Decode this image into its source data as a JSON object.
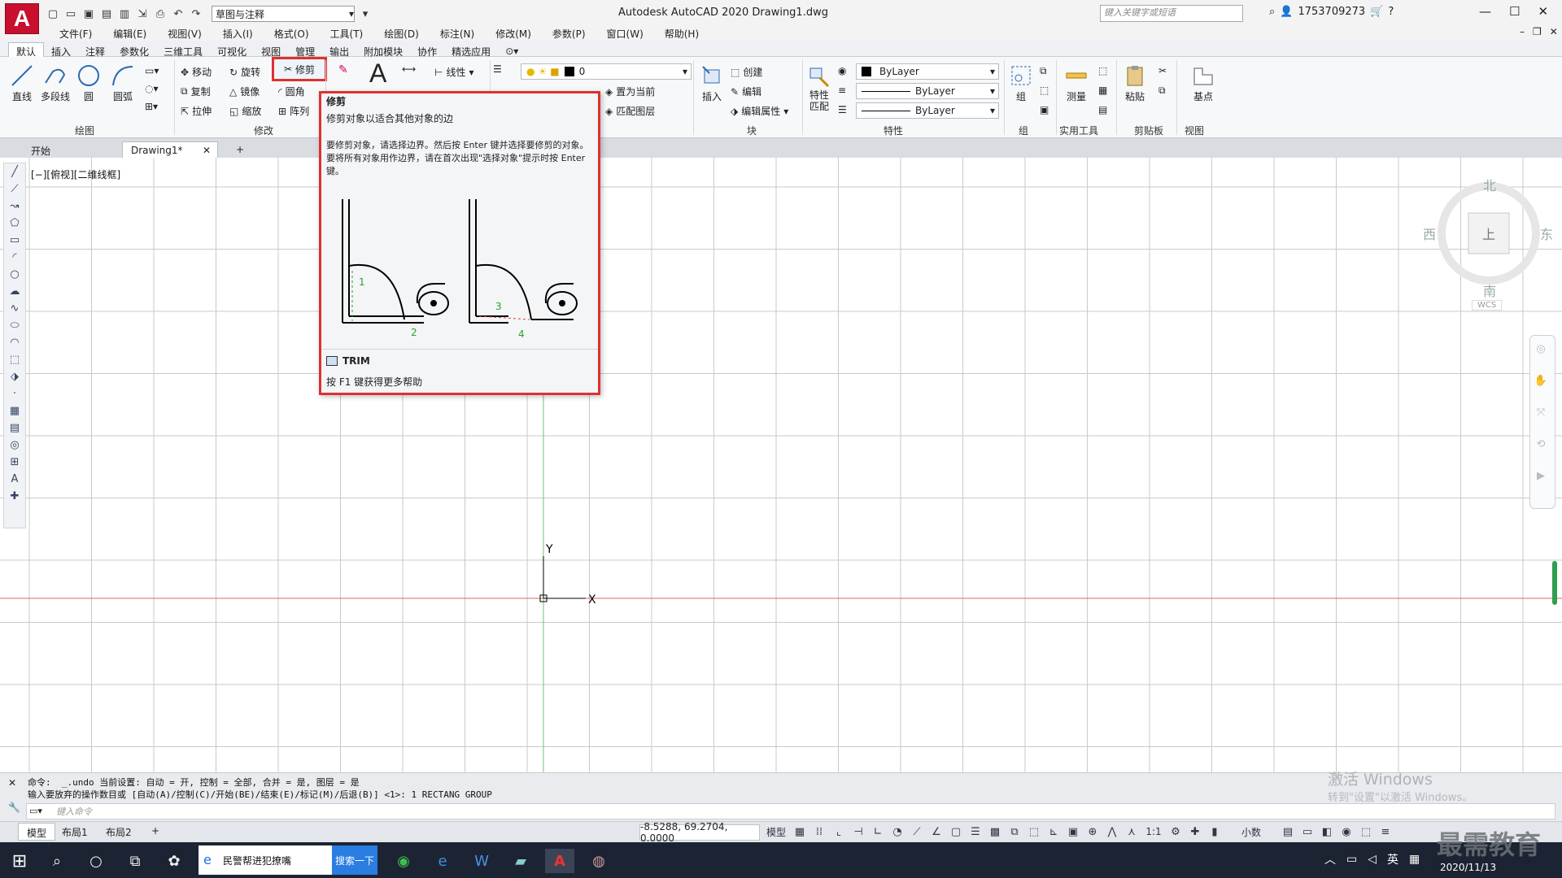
{
  "window": {
    "app_title": "Autodesk AutoCAD 2020    Drawing1.dwg",
    "logo_letter": "A",
    "workspace": "草图与注释",
    "search_placeholder": "键入关键字或短语",
    "user": "1753709273"
  },
  "menus": [
    "文件(F)",
    "编辑(E)",
    "视图(V)",
    "插入(I)",
    "格式(O)",
    "工具(T)",
    "绘图(D)",
    "标注(N)",
    "修改(M)",
    "参数(P)",
    "窗口(W)",
    "帮助(H)"
  ],
  "ribbon_tabs": [
    "默认",
    "插入",
    "注释",
    "参数化",
    "三维工具",
    "可视化",
    "视图",
    "管理",
    "输出",
    "附加模块",
    "协作",
    "精选应用"
  ],
  "ribbon": {
    "draw": {
      "label": "绘图",
      "line": "直线",
      "polyline": "多段线",
      "circle": "圆",
      "arc": "圆弧"
    },
    "modify": {
      "label": "修改",
      "move": "移动",
      "rotate": "旋转",
      "trim": "修剪",
      "copy": "复制",
      "mirror": "镜像",
      "fillet": "圆角",
      "stretch": "拉伸",
      "scale": "缩放",
      "array": "阵列"
    },
    "annotation": {
      "linear": "线性"
    },
    "layers": {
      "current_layer": "0",
      "make_current": "置为当前",
      "match_layer": "匹配图层"
    },
    "block": {
      "label": "块",
      "insert": "插入",
      "create": "创建",
      "edit": "编辑",
      "edit_attr": "编辑属性"
    },
    "properties": {
      "label": "特性",
      "match": "特性匹配",
      "color": "ByLayer",
      "linetype": "ByLayer",
      "lineweight": "ByLayer"
    },
    "groups": {
      "label": "组",
      "group": "组"
    },
    "utilities": {
      "label": "实用工具",
      "measure": "测量"
    },
    "clipboard": {
      "label": "剪贴板",
      "paste": "粘贴"
    },
    "view": {
      "label": "视图",
      "base": "基点"
    }
  },
  "file_tabs": [
    "开始",
    "Drawing1*"
  ],
  "viewport_label": "[−][俯视][二维线框]",
  "viewcube": {
    "north": "北",
    "south": "南",
    "east": "东",
    "west": "西",
    "top": "上",
    "wcs": "WCS"
  },
  "ucs": {
    "x": "X",
    "y": "Y"
  },
  "tooltip": {
    "title": "修剪",
    "subtitle": "修剪对象以适合其他对象的边",
    "description": "要修剪对象，请选择边界。然后按 Enter 键并选择要修剪的对象。要将所有对象用作边界，请在首次出现\"选择对象\"提示时按 Enter 键。",
    "labels": [
      "1",
      "2",
      "3",
      "4"
    ],
    "command": "TRIM",
    "help": "按 F1 键获得更多帮助"
  },
  "command": {
    "line1": "命令:  _.undo 当前设置: 自动 = 开, 控制 = 全部, 合并 = 是, 图层 = 是",
    "line2": "输入要放弃的操作数目或 [自动(A)/控制(C)/开始(BE)/结束(E)/标记(M)/后退(B)] <1>: 1 RECTANG GROUP",
    "placeholder": "键入命令"
  },
  "watermark": {
    "line1": "激活 Windows",
    "line2": "转到\"设置\"以激活 Windows。"
  },
  "layout_tabs": [
    "模型",
    "布局1",
    "布局2"
  ],
  "status": {
    "coords": "-8.5288, 69.2704, 0.0000",
    "model": "模型",
    "scale": "1:1",
    "units": "小数"
  },
  "taskbar": {
    "search_text": "民警帮进犯撩嘴",
    "search_button": "搜索一下",
    "ime": "英",
    "date": "2020/11/13",
    "brand": "最需教育"
  }
}
